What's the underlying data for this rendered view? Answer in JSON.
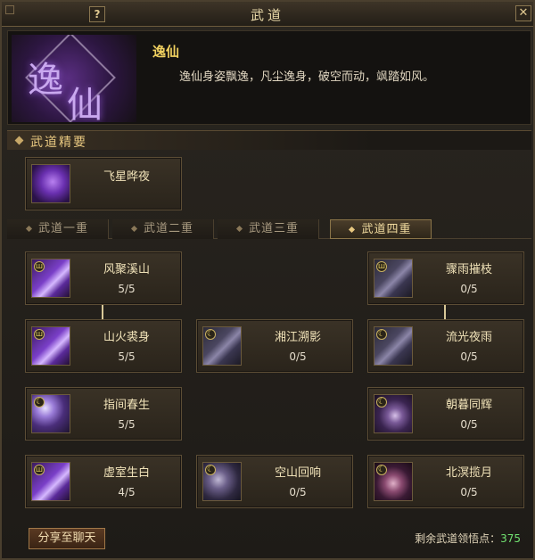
{
  "window": {
    "title": "武道",
    "help_label": "?",
    "close_label": "✕"
  },
  "header": {
    "emblem_char_1": "逸",
    "emblem_char_2": "仙",
    "name": "逸仙",
    "description": "逸仙身姿飘逸，凡尘逸身，破空而动，飒踏如风。"
  },
  "section": {
    "title": "武道精要"
  },
  "essence_skill": {
    "name": "飞星晔夜",
    "icon": "flying-figure-icon"
  },
  "tabs": [
    {
      "label": "武道一重",
      "active": false
    },
    {
      "label": "武道二重",
      "active": false
    },
    {
      "label": "武道三重",
      "active": false
    },
    {
      "label": "武道四重",
      "active": true
    }
  ],
  "skills": [
    {
      "name": "风聚溪山",
      "level": "5/5",
      "icon": "purple-slash-icon",
      "badge": "ш"
    },
    {
      "name": "骤雨摧枝",
      "level": "0/5",
      "icon": "dim-rain-icon",
      "badge": "ш"
    },
    {
      "name": "山火裘身",
      "level": "5/5",
      "icon": "purple-slash-icon",
      "badge": "ш"
    },
    {
      "name": "湘江溯影",
      "level": "0/5",
      "icon": "dim-wave-icon",
      "badge": "☾"
    },
    {
      "name": "流光夜雨",
      "level": "0/5",
      "icon": "dim-rain-icon",
      "badge": "☾"
    },
    {
      "name": "指间春生",
      "level": "5/5",
      "icon": "purple-orb-icon",
      "badge": "☾"
    },
    {
      "name": "朝暮同辉",
      "level": "0/5",
      "icon": "moon-figure-icon",
      "badge": "☾"
    },
    {
      "name": "虚室生白",
      "level": "4/5",
      "icon": "purple-slash-icon",
      "badge": "ш"
    },
    {
      "name": "空山回响",
      "level": "0/5",
      "icon": "dim-orb-icon",
      "badge": "☾"
    },
    {
      "name": "北溟揽月",
      "level": "0/5",
      "icon": "swirl-icon",
      "badge": "☾"
    }
  ],
  "footer": {
    "share_label": "分享至聊天",
    "points_label": "剩余武道领悟点：",
    "points_value": "375"
  },
  "colors": {
    "accent_gold": "#f0d060",
    "points_green": "#70e070",
    "title_text": "#e8d8a8"
  }
}
